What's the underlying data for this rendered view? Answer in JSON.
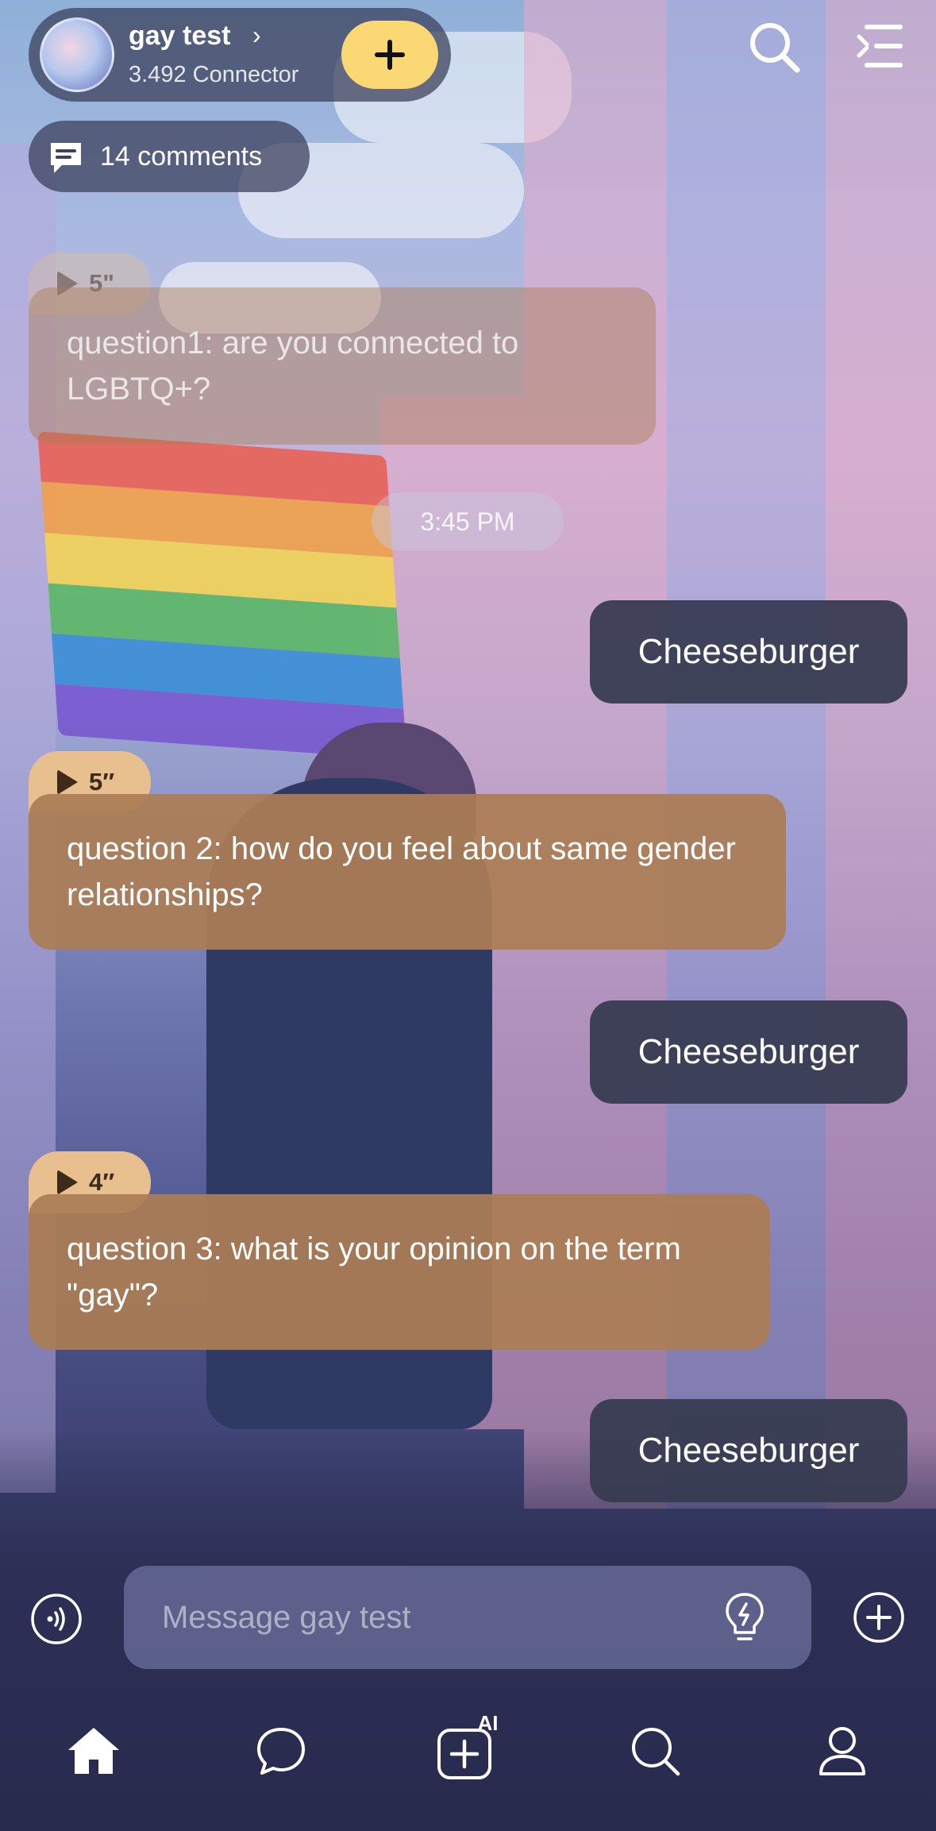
{
  "header": {
    "creator_name": "gay test",
    "creator_subtitle": "3.492 Connector",
    "follow_label": "+",
    "comments_label": "14 comments"
  },
  "messages": [
    {
      "role": "bot",
      "audio": "5\"",
      "text": "question1: are you connected to LGBTQ+?",
      "faded": true
    },
    {
      "role": "time",
      "text": "3:45 PM"
    },
    {
      "role": "user",
      "text": "Cheeseburger"
    },
    {
      "role": "bot",
      "audio": "5″",
      "text": "question 2: how do you feel about same gender relationships?"
    },
    {
      "role": "user",
      "text": "Cheeseburger"
    },
    {
      "role": "bot",
      "audio": "4″",
      "text": "question 3: what is your opinion on the term \"gay\"?"
    },
    {
      "role": "user",
      "text": "Cheeseburger"
    }
  ],
  "composer": {
    "placeholder": "Message gay test"
  },
  "nav": {
    "ai_badge": "AI",
    "items": [
      "home-icon",
      "chat-icon",
      "create-ai-icon",
      "search-icon",
      "profile-icon"
    ]
  },
  "colors": {
    "bot_bubble": "#ab7d55",
    "user_bubble": "#363a50",
    "audio_badge": "#e8bf8f",
    "follow_button": "#fbd873"
  }
}
